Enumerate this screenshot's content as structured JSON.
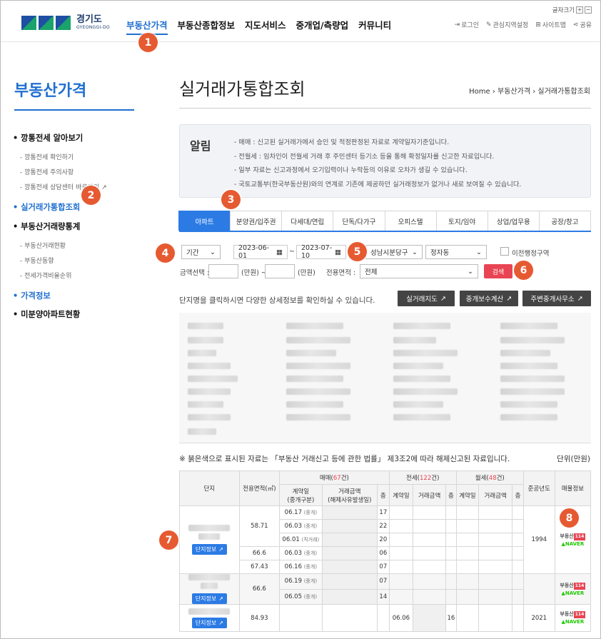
{
  "header": {
    "logo_text": "경기도",
    "logo_sub": "GYEONGGI-DO",
    "font_size_label": "글자크기",
    "nav": [
      "부동산가격",
      "부동산종합정보",
      "지도서비스",
      "중개업/측량업",
      "커뮤니티"
    ],
    "util": [
      "로그인",
      "관심지역설정",
      "사이트맵",
      "공유"
    ]
  },
  "badges": [
    "1",
    "2",
    "3",
    "4",
    "5",
    "6",
    "7",
    "8"
  ],
  "sidebar": {
    "title": "부동산가격",
    "items": [
      {
        "label": "깡통전세 알아보기",
        "level": "g"
      },
      {
        "label": "깡통전세 확인하기",
        "level": "s"
      },
      {
        "label": "깡통전세 주의사항",
        "level": "s"
      },
      {
        "label": "깡통전세 상담센터 바로가기",
        "level": "s"
      },
      {
        "label": "실거래가통합조회",
        "level": "g",
        "active": true
      },
      {
        "label": "부동산거래량통계",
        "level": "g"
      },
      {
        "label": "부동산거래현황",
        "level": "s"
      },
      {
        "label": "부동산동향",
        "level": "s"
      },
      {
        "label": "전세가격비율순위",
        "level": "s"
      },
      {
        "label": "가격정보",
        "level": "g",
        "blue": true
      },
      {
        "label": "미분양아파트현황",
        "level": "g"
      }
    ]
  },
  "main": {
    "title": "실거래가통합조회",
    "breadcrumb": [
      "Home",
      "부동산가격",
      "실거래가통합조회"
    ],
    "notice_title": "알림",
    "notices": [
      "- 매매 : 신고된 실거래가에서 승인 및 적정판정된 자료로 계약일자기준입니다.",
      "- 전월세 : 임차인이 전월세 거래 후 주민센터 등기소 등을 통해 확정일자를 신고한 자료입니다.",
      "- 일부 자료는 신고과정에서 오기입력이나 누락등의 이유로 오차가 생길 수 있습니다.",
      "- 국토교통부(한국부동산원)와의 연계로 기존에 제공하던 실거래정보가 없거나 새로 보여질 수 있습니다."
    ],
    "tabs": [
      "아파트",
      "분양권/입주권",
      "다세대/연립",
      "단독/다가구",
      "오피스텔",
      "토지/임야",
      "상업/업무용",
      "공장/창고"
    ],
    "filters": {
      "period": "기간",
      "date_from": "2023-06-01",
      "date_to": "2023-07-10",
      "tilde": "~",
      "district": "성남시분당구",
      "dong": "정자동",
      "old_admin": "이전행정구역",
      "amount_label": "금액선택 :",
      "unit_won": "(만원)",
      "unit_won_tilde": "(만원) ~",
      "area_label": "전용면적 :",
      "area_value": "전체",
      "search": "검색"
    },
    "info_text": "단지명을 클릭하시면 다양한 상세정보를 확인하실 수 있습니다.",
    "buttons": [
      "실거래지도",
      "중개보수계산",
      "주변중개사무소"
    ],
    "note": "※ 붉은색으로 표시된 자료는 「부동산 거래신고 등에 관한 법률」 제3조2에 따라 해제신고된 자료입니다.",
    "unit": "단위(만원)",
    "table": {
      "h_danji": "단지",
      "h_area": "전용면적(㎡)",
      "h_sale": "매매(",
      "sale_count": "67",
      "h_sale_suffix": "건)",
      "h_jeonse": "전세(",
      "jeonse_count": "122",
      "h_jeonse_suffix": "건)",
      "h_wolse": "월세(",
      "wolse_count": "48",
      "h_wolse_suffix": "건)",
      "h_year": "준공년도",
      "h_listing": "매물정보",
      "h_contract": "계약일",
      "h_contract_sub": "(중개구분)",
      "h_price": "거래금액",
      "h_price_sub": "(해제사유발생일)",
      "h_floor": "층",
      "h_j_contract": "계약일",
      "h_j_price": "거래금액",
      "h_w_contract": "계약일",
      "h_w_price": "거래금액",
      "danji_btn": "단지정보",
      "rows": [
        {
          "area": "58.71",
          "date": "06.17",
          "type": "(중개)",
          "floor": "17"
        },
        {
          "area": "",
          "date": "06.03",
          "type": "(중개)",
          "floor": "22"
        },
        {
          "area": "",
          "date": "06.01",
          "type": "(직거래)",
          "floor": "20"
        },
        {
          "area": "66.6",
          "date": "06.03",
          "type": "(중개)",
          "floor": "06"
        },
        {
          "area": "67.43",
          "date": "06.16",
          "type": "(중개)",
          "floor": "07"
        },
        {
          "area": "66.6",
          "date": "06.19",
          "type": "(중개)",
          "floor": "07"
        },
        {
          "area": "",
          "date": "06.05",
          "type": "(중개)",
          "floor": "14"
        },
        {
          "area": "84.93",
          "date": "",
          "type": "",
          "floor": "",
          "j_date": "06.06",
          "j_floor": "16"
        }
      ],
      "year1": "1994",
      "year2": "2021",
      "partner1": "부동산",
      "partner1_tag": "114",
      "partner2": "NAVER"
    }
  }
}
